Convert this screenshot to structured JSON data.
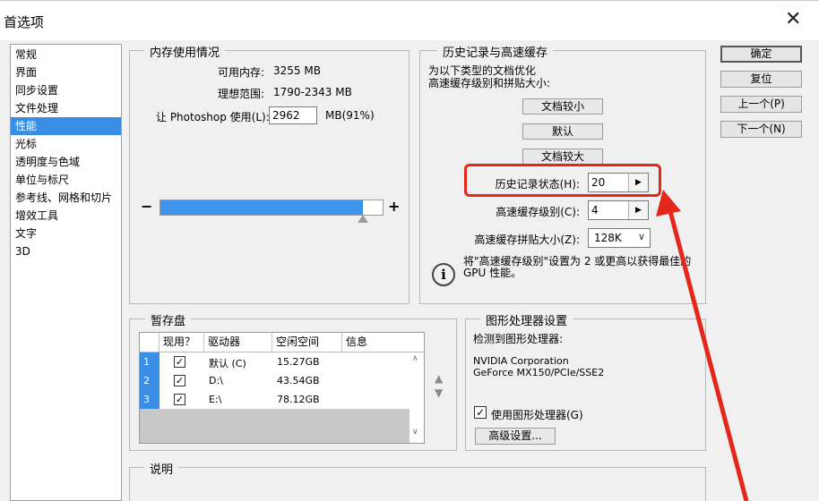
{
  "window": {
    "title": "首选项"
  },
  "sidebar": {
    "items": [
      {
        "label": "常规"
      },
      {
        "label": "界面"
      },
      {
        "label": "同步设置"
      },
      {
        "label": "文件处理"
      },
      {
        "label": "性能",
        "selected": true
      },
      {
        "label": "光标"
      },
      {
        "label": "透明度与色域"
      },
      {
        "label": "单位与标尺"
      },
      {
        "label": "参考线、网格和切片"
      },
      {
        "label": "增效工具"
      },
      {
        "label": "文字"
      },
      {
        "label": "3D"
      }
    ]
  },
  "memory": {
    "title": "内存使用情况",
    "available_label": "可用内存:",
    "available_value": "3255 MB",
    "ideal_label": "理想范围:",
    "ideal_value": "1790-2343 MB",
    "usage_label": "让 Photoshop 使用(L):",
    "usage_value": "2962",
    "usage_suffix": "MB(91%)",
    "slider_fraction": 0.91,
    "minus": "−",
    "plus": "+"
  },
  "history": {
    "title": "历史记录与高速缓存",
    "desc_line1": "为以下类型的文档优化",
    "desc_line2": "高速缓存级别和拼贴大小:",
    "btn_small": "文档较小",
    "btn_default": "默认",
    "btn_large": "文档较大",
    "states_label": "历史记录状态(H):",
    "states_value": "20",
    "cache_levels_label": "高速缓存级别(C):",
    "cache_levels_value": "4",
    "tile_size_label": "高速缓存拼贴大小(Z):",
    "tile_size_value": "128K",
    "info_line1": "将\"高速缓存级别\"设置为 2 或更高以获得最佳的",
    "info_line2": "GPU 性能。"
  },
  "scratch": {
    "title": "暂存盘",
    "headers": {
      "active": "现用？",
      "drive": "驱动器",
      "free": "空闲空间",
      "info": "信息"
    },
    "rows": [
      {
        "num": "1",
        "check": "✓",
        "drive": "默认 (C)",
        "free": "15.27GB"
      },
      {
        "num": "2",
        "check": "✓",
        "drive": "D:\\",
        "free": "43.54GB"
      },
      {
        "num": "3",
        "check": "✓",
        "drive": "E:\\",
        "free": "78.12GB"
      }
    ]
  },
  "gpu": {
    "title": "图形处理器设置",
    "detected_label": "检测到图形处理器:",
    "vendor": "NVIDIA Corporation",
    "model": "GeForce MX150/PCIe/SSE2",
    "use_gpu_label": "使用图形处理器(G)",
    "use_gpu_check": "✓",
    "advanced_button": "高级设置..."
  },
  "description": {
    "title": "说明"
  },
  "buttons": {
    "ok": "确定",
    "reset": "复位",
    "prev": "上一个(P)",
    "next": "下一个(N)"
  },
  "colors": {
    "selection": "#3a8ee6",
    "annotation": "#e3271b"
  }
}
